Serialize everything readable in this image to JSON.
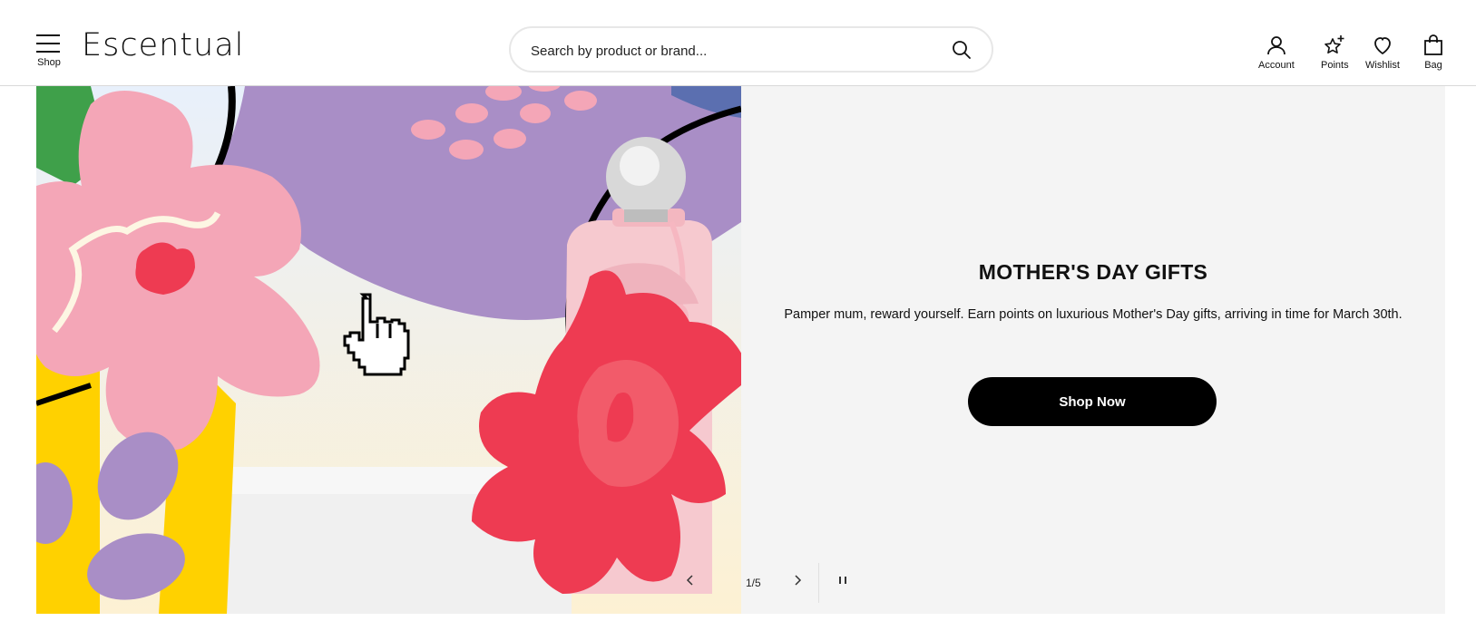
{
  "header": {
    "shop_label": "Shop",
    "logo": "Escentual",
    "search": {
      "placeholder": "Search by product or brand..."
    },
    "icons": [
      {
        "name": "account",
        "label": "Account"
      },
      {
        "name": "points",
        "label": "Points"
      },
      {
        "name": "wishlist",
        "label": "Wishlist"
      },
      {
        "name": "bag",
        "label": "Bag"
      }
    ]
  },
  "hero": {
    "title": "MOTHER'S DAY GIFTS",
    "description": "Pamper mum, reward yourself. Earn points on luxurious Mother's Day gifts, arriving in time for March 30th.",
    "cta_label": "Shop Now",
    "slide_counter": "1/5"
  },
  "colors": {
    "pink": "#f4a6b7",
    "red": "#ee3b52",
    "purple": "#a98ec6",
    "yellow": "#ffd100",
    "green": "#3fa04a",
    "button_bg": "#000000",
    "panel_bg": "#f4f4f4"
  }
}
